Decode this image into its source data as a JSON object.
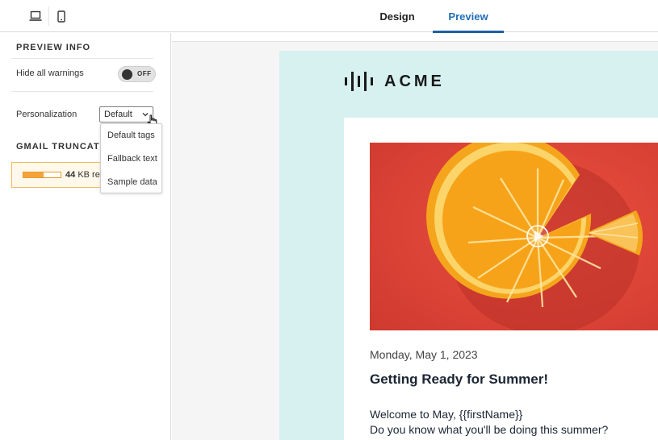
{
  "header": {
    "device_toggle": [
      {
        "icon": "laptop-icon",
        "label": "Desktop"
      },
      {
        "icon": "mobile-icon",
        "label": "Mobile"
      }
    ],
    "tabs": [
      {
        "label": "Design",
        "active": false
      },
      {
        "label": "Preview",
        "active": true
      }
    ],
    "accent_color": "#1f5fa3"
  },
  "sidebar": {
    "preview_info": {
      "title": "PREVIEW INFO",
      "hide_warnings_label": "Hide all warnings",
      "hide_warnings_state": "OFF",
      "personalization_label": "Personalization",
      "personalization_value": "Default",
      "personalization_options": [
        "Default tags",
        "Fallback text",
        "Sample data"
      ]
    },
    "gmail_truncation": {
      "title": "GMAIL TRUNCATION",
      "size_number": "44",
      "size_text": "KB ren",
      "bar_fill_fraction": 0.55,
      "warning_color": "#f3a33b"
    }
  },
  "email": {
    "brand": "ACME",
    "hero_icon": "play-icon",
    "date": "Monday, May 1, 2023",
    "heading": "Getting Ready for Summer!",
    "body_lines": [
      "Welcome to May, {{firstName}}",
      "Do you know what you'll be doing this summer?"
    ],
    "background_color": "#d7f0f0"
  }
}
